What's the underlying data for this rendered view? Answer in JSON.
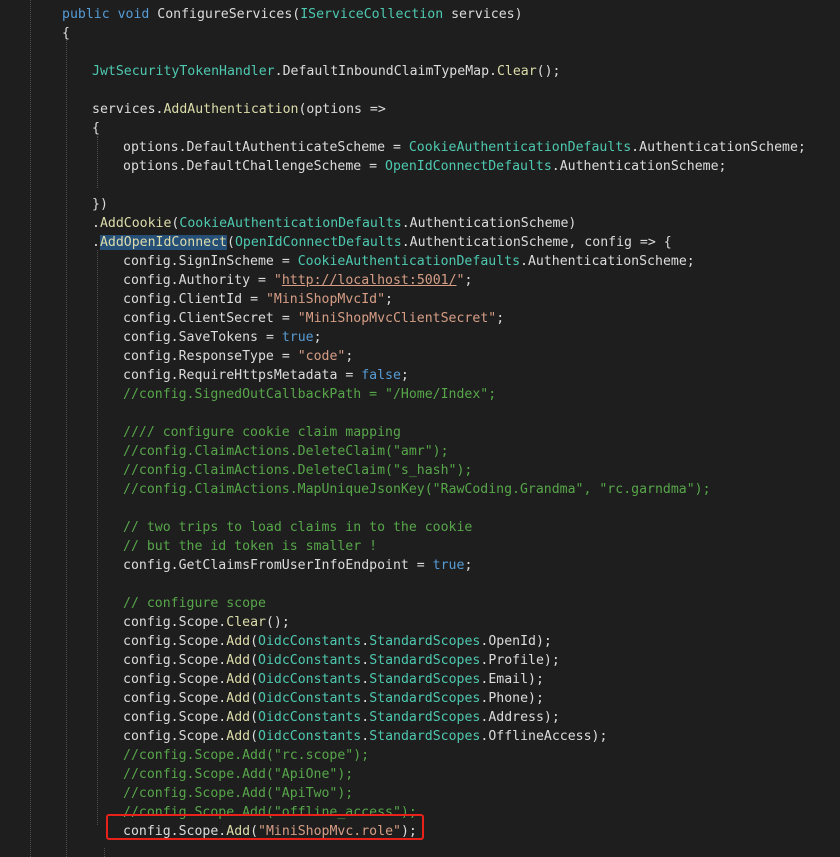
{
  "code": {
    "lines": [
      [
        {
          "t": "public ",
          "c": "kw"
        },
        {
          "t": "void ",
          "c": "kw"
        },
        {
          "t": "ConfigureServices",
          "c": "pl"
        },
        {
          "t": "(",
          "c": "pl"
        },
        {
          "t": "IServiceCollection",
          "c": "ty"
        },
        {
          "t": " services)",
          "c": "pl"
        }
      ],
      [
        {
          "t": "{",
          "c": "pl"
        }
      ],
      [],
      [
        {
          "t": "JwtSecurityTokenHandler",
          "c": "ty"
        },
        {
          "t": ".",
          "c": "pl"
        },
        {
          "t": "DefaultInboundClaimTypeMap",
          "c": "pl"
        },
        {
          "t": ".",
          "c": "pl"
        },
        {
          "t": "Clear",
          "c": "me"
        },
        {
          "t": "();",
          "c": "pl"
        }
      ],
      [],
      [
        {
          "t": "services",
          "c": "pl"
        },
        {
          "t": ".",
          "c": "pl"
        },
        {
          "t": "AddAuthentication",
          "c": "me"
        },
        {
          "t": "(options =>",
          "c": "pl"
        }
      ],
      [
        {
          "t": "{",
          "c": "pl"
        }
      ],
      [
        {
          "t": "options",
          "c": "pl"
        },
        {
          "t": ".",
          "c": "pl"
        },
        {
          "t": "DefaultAuthenticateScheme",
          "c": "pl"
        },
        {
          "t": " = ",
          "c": "pl"
        },
        {
          "t": "CookieAuthenticationDefaults",
          "c": "ty"
        },
        {
          "t": ".",
          "c": "pl"
        },
        {
          "t": "AuthenticationScheme;",
          "c": "pl"
        }
      ],
      [
        {
          "t": "options",
          "c": "pl"
        },
        {
          "t": ".",
          "c": "pl"
        },
        {
          "t": "DefaultChallengeScheme",
          "c": "pl"
        },
        {
          "t": " = ",
          "c": "pl"
        },
        {
          "t": "OpenIdConnectDefaults",
          "c": "ty"
        },
        {
          "t": ".",
          "c": "pl"
        },
        {
          "t": "AuthenticationScheme;",
          "c": "pl"
        }
      ],
      [],
      [
        {
          "t": "})",
          "c": "pl"
        }
      ],
      [
        {
          "t": ".",
          "c": "pl"
        },
        {
          "t": "AddCookie",
          "c": "me"
        },
        {
          "t": "(",
          "c": "pl"
        },
        {
          "t": "CookieAuthenticationDefaults",
          "c": "ty"
        },
        {
          "t": ".",
          "c": "pl"
        },
        {
          "t": "AuthenticationScheme)",
          "c": "pl"
        }
      ],
      [
        {
          "t": ".",
          "c": "pl"
        },
        {
          "t": "AddOpenIdConnect",
          "c": "sel"
        },
        {
          "t": "(",
          "c": "pl"
        },
        {
          "t": "OpenIdConnectDefaults",
          "c": "ty"
        },
        {
          "t": ".",
          "c": "pl"
        },
        {
          "t": "AuthenticationScheme, config => {",
          "c": "pl"
        }
      ],
      [
        {
          "t": "config",
          "c": "pl"
        },
        {
          "t": ".",
          "c": "pl"
        },
        {
          "t": "SignInScheme",
          "c": "pl"
        },
        {
          "t": " = ",
          "c": "pl"
        },
        {
          "t": "CookieAuthenticationDefaults",
          "c": "ty"
        },
        {
          "t": ".",
          "c": "pl"
        },
        {
          "t": "AuthenticationScheme;",
          "c": "pl"
        }
      ],
      [
        {
          "t": "config",
          "c": "pl"
        },
        {
          "t": ".",
          "c": "pl"
        },
        {
          "t": "Authority",
          "c": "pl"
        },
        {
          "t": " = ",
          "c": "pl"
        },
        {
          "t": "\"",
          "c": "st"
        },
        {
          "t": "http://localhost:5001/",
          "c": "ur"
        },
        {
          "t": "\"",
          "c": "st"
        },
        {
          "t": ";",
          "c": "pl"
        }
      ],
      [
        {
          "t": "config",
          "c": "pl"
        },
        {
          "t": ".",
          "c": "pl"
        },
        {
          "t": "ClientId",
          "c": "pl"
        },
        {
          "t": " = ",
          "c": "pl"
        },
        {
          "t": "\"MiniShopMvcId\"",
          "c": "st"
        },
        {
          "t": ";",
          "c": "pl"
        }
      ],
      [
        {
          "t": "config",
          "c": "pl"
        },
        {
          "t": ".",
          "c": "pl"
        },
        {
          "t": "ClientSecret",
          "c": "pl"
        },
        {
          "t": " = ",
          "c": "pl"
        },
        {
          "t": "\"MiniShopMvcClientSecret\"",
          "c": "st"
        },
        {
          "t": ";",
          "c": "pl"
        }
      ],
      [
        {
          "t": "config",
          "c": "pl"
        },
        {
          "t": ".",
          "c": "pl"
        },
        {
          "t": "SaveTokens",
          "c": "pl"
        },
        {
          "t": " = ",
          "c": "pl"
        },
        {
          "t": "true",
          "c": "kw"
        },
        {
          "t": ";",
          "c": "pl"
        }
      ],
      [
        {
          "t": "config",
          "c": "pl"
        },
        {
          "t": ".",
          "c": "pl"
        },
        {
          "t": "ResponseType",
          "c": "pl"
        },
        {
          "t": " = ",
          "c": "pl"
        },
        {
          "t": "\"code\"",
          "c": "st"
        },
        {
          "t": ";",
          "c": "pl"
        }
      ],
      [
        {
          "t": "config",
          "c": "pl"
        },
        {
          "t": ".",
          "c": "pl"
        },
        {
          "t": "RequireHttpsMetadata",
          "c": "pl"
        },
        {
          "t": " = ",
          "c": "pl"
        },
        {
          "t": "false",
          "c": "kw"
        },
        {
          "t": ";",
          "c": "pl"
        }
      ],
      [
        {
          "t": "//config.SignedOutCallbackPath = \"/Home/Index\";",
          "c": "co"
        }
      ],
      [],
      [
        {
          "t": "//// configure cookie claim mapping",
          "c": "co"
        }
      ],
      [
        {
          "t": "//config.ClaimActions.DeleteClaim(\"amr\");",
          "c": "co"
        }
      ],
      [
        {
          "t": "//config.ClaimActions.DeleteClaim(\"s_hash\");",
          "c": "co"
        }
      ],
      [
        {
          "t": "//config.ClaimActions.MapUniqueJsonKey(\"RawCoding.Grandma\", \"rc.garndma\");",
          "c": "co"
        }
      ],
      [],
      [
        {
          "t": "// two trips to load claims in to the cookie",
          "c": "co"
        }
      ],
      [
        {
          "t": "// but the id token is smaller !",
          "c": "co"
        }
      ],
      [
        {
          "t": "config",
          "c": "pl"
        },
        {
          "t": ".",
          "c": "pl"
        },
        {
          "t": "GetClaimsFromUserInfoEndpoint",
          "c": "pl"
        },
        {
          "t": " = ",
          "c": "pl"
        },
        {
          "t": "true",
          "c": "kw"
        },
        {
          "t": ";",
          "c": "pl"
        }
      ],
      [],
      [
        {
          "t": "// configure scope",
          "c": "co"
        }
      ],
      [
        {
          "t": "config",
          "c": "pl"
        },
        {
          "t": ".",
          "c": "pl"
        },
        {
          "t": "Scope",
          "c": "pl"
        },
        {
          "t": ".",
          "c": "pl"
        },
        {
          "t": "Clear",
          "c": "me"
        },
        {
          "t": "();",
          "c": "pl"
        }
      ],
      [
        {
          "t": "config",
          "c": "pl"
        },
        {
          "t": ".",
          "c": "pl"
        },
        {
          "t": "Scope",
          "c": "pl"
        },
        {
          "t": ".",
          "c": "pl"
        },
        {
          "t": "Add",
          "c": "me"
        },
        {
          "t": "(",
          "c": "pl"
        },
        {
          "t": "OidcConstants",
          "c": "ty"
        },
        {
          "t": ".",
          "c": "pl"
        },
        {
          "t": "StandardScopes",
          "c": "ty"
        },
        {
          "t": ".",
          "c": "pl"
        },
        {
          "t": "OpenId);",
          "c": "pl"
        }
      ],
      [
        {
          "t": "config",
          "c": "pl"
        },
        {
          "t": ".",
          "c": "pl"
        },
        {
          "t": "Scope",
          "c": "pl"
        },
        {
          "t": ".",
          "c": "pl"
        },
        {
          "t": "Add",
          "c": "me"
        },
        {
          "t": "(",
          "c": "pl"
        },
        {
          "t": "OidcConstants",
          "c": "ty"
        },
        {
          "t": ".",
          "c": "pl"
        },
        {
          "t": "StandardScopes",
          "c": "ty"
        },
        {
          "t": ".",
          "c": "pl"
        },
        {
          "t": "Profile);",
          "c": "pl"
        }
      ],
      [
        {
          "t": "config",
          "c": "pl"
        },
        {
          "t": ".",
          "c": "pl"
        },
        {
          "t": "Scope",
          "c": "pl"
        },
        {
          "t": ".",
          "c": "pl"
        },
        {
          "t": "Add",
          "c": "me"
        },
        {
          "t": "(",
          "c": "pl"
        },
        {
          "t": "OidcConstants",
          "c": "ty"
        },
        {
          "t": ".",
          "c": "pl"
        },
        {
          "t": "StandardScopes",
          "c": "ty"
        },
        {
          "t": ".",
          "c": "pl"
        },
        {
          "t": "Email);",
          "c": "pl"
        }
      ],
      [
        {
          "t": "config",
          "c": "pl"
        },
        {
          "t": ".",
          "c": "pl"
        },
        {
          "t": "Scope",
          "c": "pl"
        },
        {
          "t": ".",
          "c": "pl"
        },
        {
          "t": "Add",
          "c": "me"
        },
        {
          "t": "(",
          "c": "pl"
        },
        {
          "t": "OidcConstants",
          "c": "ty"
        },
        {
          "t": ".",
          "c": "pl"
        },
        {
          "t": "StandardScopes",
          "c": "ty"
        },
        {
          "t": ".",
          "c": "pl"
        },
        {
          "t": "Phone);",
          "c": "pl"
        }
      ],
      [
        {
          "t": "config",
          "c": "pl"
        },
        {
          "t": ".",
          "c": "pl"
        },
        {
          "t": "Scope",
          "c": "pl"
        },
        {
          "t": ".",
          "c": "pl"
        },
        {
          "t": "Add",
          "c": "me"
        },
        {
          "t": "(",
          "c": "pl"
        },
        {
          "t": "OidcConstants",
          "c": "ty"
        },
        {
          "t": ".",
          "c": "pl"
        },
        {
          "t": "StandardScopes",
          "c": "ty"
        },
        {
          "t": ".",
          "c": "pl"
        },
        {
          "t": "Address);",
          "c": "pl"
        }
      ],
      [
        {
          "t": "config",
          "c": "pl"
        },
        {
          "t": ".",
          "c": "pl"
        },
        {
          "t": "Scope",
          "c": "pl"
        },
        {
          "t": ".",
          "c": "pl"
        },
        {
          "t": "Add",
          "c": "me"
        },
        {
          "t": "(",
          "c": "pl"
        },
        {
          "t": "OidcConstants",
          "c": "ty"
        },
        {
          "t": ".",
          "c": "pl"
        },
        {
          "t": "StandardScopes",
          "c": "ty"
        },
        {
          "t": ".",
          "c": "pl"
        },
        {
          "t": "OfflineAccess);",
          "c": "pl"
        }
      ],
      [
        {
          "t": "//config.Scope.Add(\"rc.scope\");",
          "c": "co"
        }
      ],
      [
        {
          "t": "//config.Scope.Add(\"ApiOne\");",
          "c": "co"
        }
      ],
      [
        {
          "t": "//config.Scope.Add(\"ApiTwo\");",
          "c": "co"
        }
      ],
      [
        {
          "t": "//config.Scope.Add(\"offline_access\");",
          "c": "co"
        }
      ],
      [
        {
          "t": "config",
          "c": "pl"
        },
        {
          "t": ".",
          "c": "pl"
        },
        {
          "t": "Scope",
          "c": "pl"
        },
        {
          "t": ".",
          "c": "pl"
        },
        {
          "t": "Add",
          "c": "me"
        },
        {
          "t": "(",
          "c": "pl"
        },
        {
          "t": "\"MiniShopMvc.role\"",
          "c": "st"
        },
        {
          "t": ");",
          "c": "pl"
        }
      ]
    ]
  },
  "colors": {
    "background": "#1e1e1e",
    "keyword": "#569cd6",
    "type": "#4ec9b0",
    "method": "#dcdcaa",
    "string": "#d69d85",
    "comment": "#57a64a",
    "plain": "#dcdcdc",
    "selection": "#264f78",
    "highlight_box": "#e8211b"
  }
}
